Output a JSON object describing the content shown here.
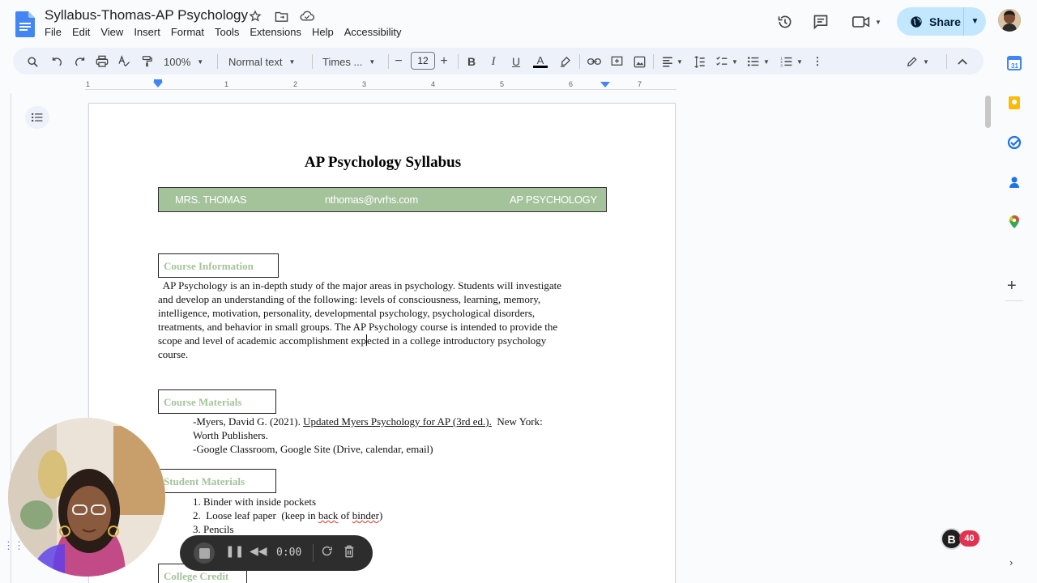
{
  "window": {
    "title": "Syllabus-Thomas-AP Psychology"
  },
  "menu": [
    "File",
    "Edit",
    "View",
    "Insert",
    "Format",
    "Tools",
    "Extensions",
    "Help",
    "Accessibility"
  ],
  "share": {
    "label": "Share"
  },
  "toolbar": {
    "zoom": "100%",
    "style": "Normal text",
    "font": "Times ...",
    "font_size": "12"
  },
  "ruler": {
    "labels": [
      "1",
      "1",
      "2",
      "3",
      "4",
      "5",
      "6",
      "7"
    ]
  },
  "document": {
    "title": "AP Psychology Syllabus",
    "banner": {
      "teacher": "MRS. THOMAS",
      "email": "nthomas@rvrhs.com",
      "course": "AP PSYCHOLOGY"
    },
    "course_info": {
      "heading": "Course Information",
      "lines": [
        "  AP Psychology is an in-depth study of the major areas in psychology. Students will investigate",
        "and develop an understanding of the following: levels of consciousness, learning, memory,",
        "intelligence, motivation, personality, developmental psychology, psychological disorders,",
        "treatments, and behavior in small groups. The AP Psychology course is intended to provide the",
        "scope and level of academic accomplishment exp",
        "ected in a college introductory psychology",
        "course."
      ]
    },
    "course_materials": {
      "heading": "Course Materials",
      "line1_prefix": "-Myers, David G. (2021). ",
      "line1_book": "Updated Myers Psychology for AP (3rd ed.).",
      "line1_suffix": "  New York:",
      "line2": "Worth Publishers.",
      "line3": "-Google Classroom, Google Site (Drive, calendar, email)"
    },
    "student_materials": {
      "heading": "Student Materials",
      "item1": "1.  Binder with inside pockets",
      "item2_a": "2.  Loose leaf paper  (keep in ",
      "item2_b": "back",
      "item2_c": " of ",
      "item2_d": "binder",
      "item2_e": ")",
      "item3": "3.  Pencils"
    },
    "college_credit": {
      "heading": "College Credit"
    }
  },
  "recorder": {
    "time": "0:00"
  },
  "badge": {
    "letter": "B",
    "count": "40"
  }
}
